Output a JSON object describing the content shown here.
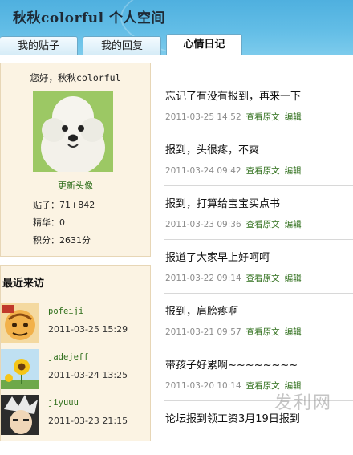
{
  "header": {
    "title": "秋秋colorful 个人空间"
  },
  "tabs": [
    {
      "label": "我的贴子"
    },
    {
      "label": "我的回复"
    },
    {
      "label": "心情日记"
    }
  ],
  "profile": {
    "greeting": "您好，秋秋colorful",
    "update_avatar": "更新头像",
    "posts": "贴子：71+842",
    "elite": "精华：0",
    "points": "积分：2631分"
  },
  "recent": {
    "title": "最近来访",
    "visitors": [
      {
        "name": "pofeiji",
        "time": "2011-03-25 15:29"
      },
      {
        "name": "jadejeff",
        "time": "2011-03-24 13:25"
      },
      {
        "name": "jiyuuu",
        "time": "2011-03-23 21:15"
      }
    ]
  },
  "diary": {
    "view_label": "查看原文",
    "edit_label": "编辑",
    "entries": [
      {
        "title": "忘记了有没有报到，再来一下",
        "date": "2011-03-25 14:52"
      },
      {
        "title": "报到，头很疼，不爽",
        "date": "2011-03-24 09:42"
      },
      {
        "title": "报到，打算给宝宝买点书",
        "date": "2011-03-23 09:36"
      },
      {
        "title": "报道了大家早上好呵呵",
        "date": "2011-03-22 09:14"
      },
      {
        "title": "报到，肩膀疼啊",
        "date": "2011-03-21 09:57"
      },
      {
        "title": "带孩子好累啊~~~~~~~~",
        "date": "2011-03-20 10:14"
      },
      {
        "title": "论坛报到领工资3月19日报到",
        "date": ""
      }
    ]
  },
  "watermark": {
    "text": "发利网",
    "sub": ""
  }
}
